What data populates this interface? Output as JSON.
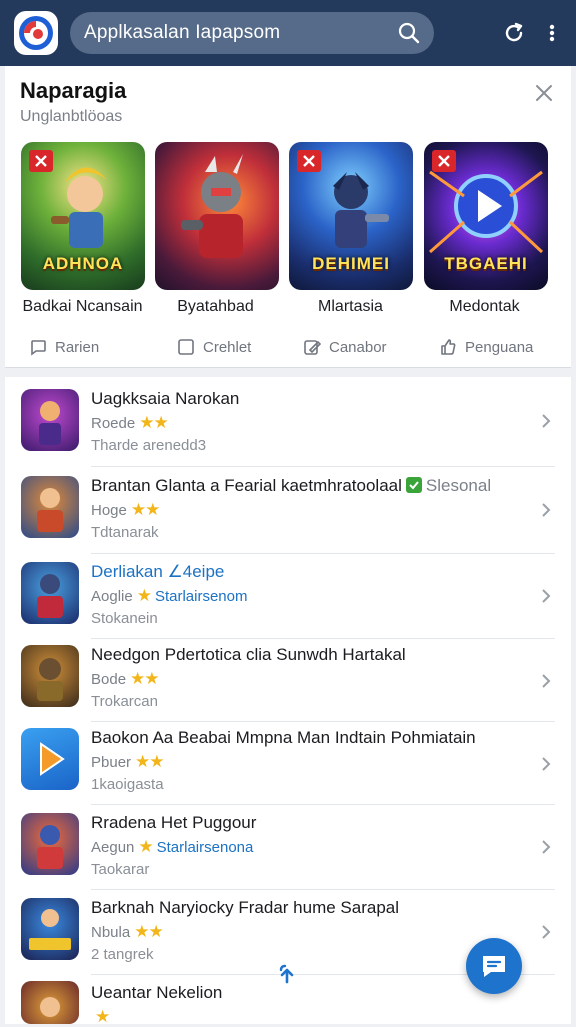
{
  "search": {
    "placeholder": "Applkasalan Iapapsom"
  },
  "icons": {
    "logo": "app-logo",
    "search": "search-icon",
    "refresh": "refresh-icon",
    "more": "more-vertical-icon",
    "close": "close-icon",
    "chevron": "chevron-right-icon",
    "fab": "chat-icon",
    "reload": "reload-icon"
  },
  "colors": {
    "topbar": "#243a5c",
    "search_bg": "#566b89",
    "accent": "#1e73cc",
    "star": "#f2b61a",
    "badge_red": "#d9262b",
    "badge_green": "#3aa33a"
  },
  "featured": {
    "title": "Naparagia",
    "subtitle": "Unglanbtlöoas",
    "tiles": [
      {
        "label": "Badkai Ncansain",
        "art_text": "ADHNOA"
      },
      {
        "label": "Byatahbad",
        "art_text": ""
      },
      {
        "label": "Mlartasia",
        "art_text": "DEHIMEI"
      },
      {
        "label": "Medontak",
        "art_text": "TBGAEHI"
      }
    ],
    "actions": [
      {
        "label": "Rarien",
        "icon": "speech-bubble-icon"
      },
      {
        "label": "Crehlet",
        "icon": "square-icon"
      },
      {
        "label": "Canabor",
        "icon": "edit-icon"
      },
      {
        "label": "Penguana",
        "icon": "thumb-icon"
      }
    ]
  },
  "list": [
    {
      "title": "Uagkksaia Narokan",
      "meta": "Roede",
      "stars": "★★",
      "extra": "",
      "sub": "Tharde arenedd3",
      "link": false
    },
    {
      "title": "Brantan Glanta a Fearial kaetmhratoolaal",
      "badge_text": "Slesonal",
      "meta": "Hoge",
      "stars": "★★",
      "extra": "",
      "sub": "Tdtanarak",
      "link": false
    },
    {
      "title": "Derliakan ∠4eipe",
      "meta": "Aoglie",
      "stars": "★",
      "extra": "Starlairsenom",
      "sub": "Stokanein",
      "link": true
    },
    {
      "title": "Needgon Pdertotica clia Sunwdh Hartakal",
      "meta": "Bode",
      "stars": "★★",
      "extra": "",
      "sub": "Trokarcan",
      "link": false
    },
    {
      "title": "Baokon Aa Beabai Mmpna Man Indtain Pohmiatain",
      "meta": "Pbuer",
      "stars": "★★",
      "extra": "",
      "sub": "1kaoigasta",
      "link": false
    },
    {
      "title": "Rradena Het Puggour",
      "meta": "Aegun",
      "stars": "★",
      "extra": "Starlairsenona",
      "sub": "Taokarar",
      "link": false
    },
    {
      "title": "Barknah Naryiocky Fradar hume Sarapal",
      "meta": "Nbula",
      "stars": "★★",
      "extra": "",
      "sub": "2 tangrek",
      "link": false
    },
    {
      "title": "Ueantar Nekelion",
      "meta": "",
      "stars": "★",
      "extra": "",
      "sub": "",
      "link": false
    }
  ]
}
